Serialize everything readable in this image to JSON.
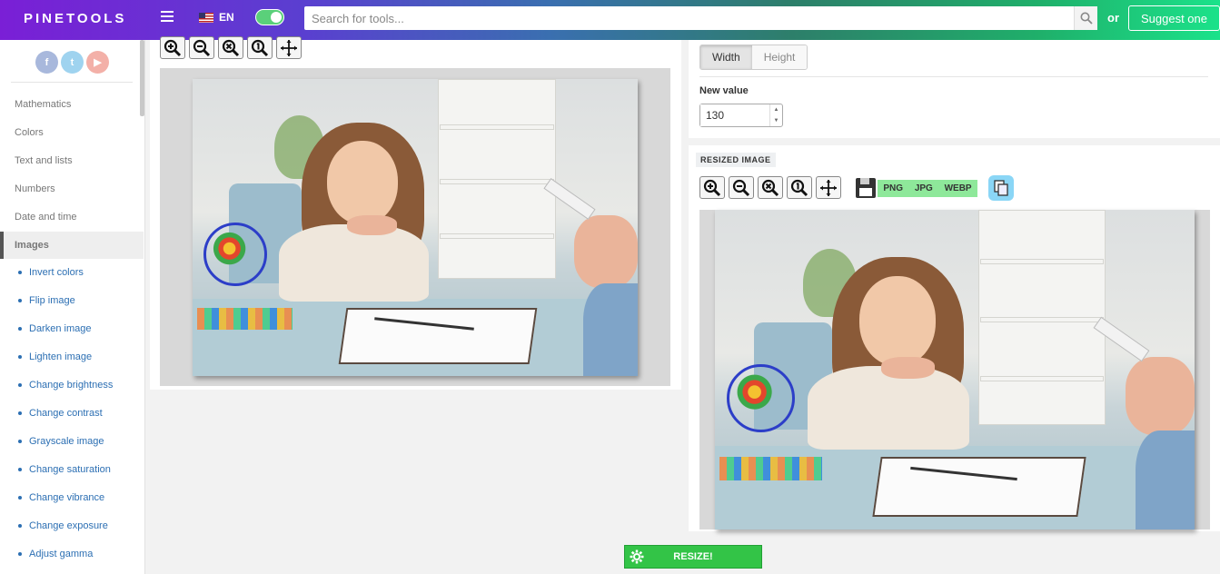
{
  "header": {
    "logo": "PINETOOLS",
    "language": "EN",
    "search_placeholder": "Search for tools...",
    "or_text": "or",
    "suggest_label": "Suggest one"
  },
  "sidebar": {
    "categories": [
      {
        "label": "Mathematics"
      },
      {
        "label": "Colors"
      },
      {
        "label": "Text and lists"
      },
      {
        "label": "Numbers"
      },
      {
        "label": "Date and time"
      }
    ],
    "active_category": "Images",
    "sub_items": [
      {
        "label": "Invert colors"
      },
      {
        "label": "Flip image"
      },
      {
        "label": "Darken image"
      },
      {
        "label": "Lighten image"
      },
      {
        "label": "Change brightness"
      },
      {
        "label": "Change contrast"
      },
      {
        "label": "Grayscale image"
      },
      {
        "label": "Change saturation"
      },
      {
        "label": "Change vibrance"
      },
      {
        "label": "Change exposure"
      },
      {
        "label": "Adjust gamma"
      }
    ]
  },
  "options": {
    "tabs": [
      {
        "label": "Width",
        "active": true
      },
      {
        "label": "Height",
        "active": false
      }
    ],
    "new_value_label": "New value",
    "new_value": "130"
  },
  "resized": {
    "title": "RESIZED IMAGE",
    "formats": [
      "PNG",
      "JPG",
      "WEBP"
    ]
  },
  "resize_button": "RESIZE!",
  "colors": {
    "accent_green": "#33c447",
    "link_blue": "#2c6fb3",
    "format_bar": "#8ee89a",
    "copy_button": "#8ad6f6"
  }
}
